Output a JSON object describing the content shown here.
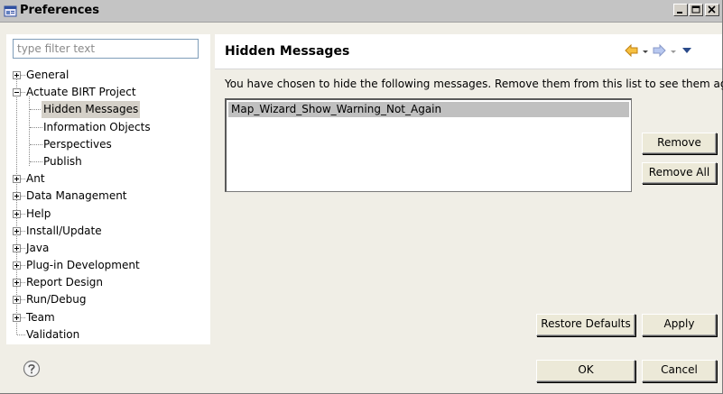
{
  "window": {
    "title": "Preferences"
  },
  "filter": {
    "placeholder": "type filter text"
  },
  "tree": {
    "general": "General",
    "actuate": "Actuate BIRT Project",
    "hidden_messages": "Hidden Messages",
    "information_objects": "Information Objects",
    "perspectives": "Perspectives",
    "publish": "Publish",
    "ant": "Ant",
    "data_management": "Data Management",
    "help": "Help",
    "install_update": "Install/Update",
    "java": "Java",
    "plugin_development": "Plug-in Development",
    "report_design": "Report Design",
    "run_debug": "Run/Debug",
    "team": "Team",
    "validation": "Validation"
  },
  "page": {
    "title": "Hidden Messages",
    "description": "You have chosen to hide the following messages. Remove them from this list to see them again.",
    "messages": [
      "Map_Wizard_Show_Warning_Not_Again"
    ],
    "remove_label": "Remove",
    "remove_all_label": "Remove All",
    "restore_defaults_label": "Restore Defaults",
    "apply_label": "Apply"
  },
  "dialog": {
    "ok_label": "OK",
    "cancel_label": "Cancel"
  },
  "colors": {
    "selection": "#d4d0c8",
    "list_selection": "#c0c0c0",
    "nav_back": "#f0b020",
    "nav_forward": "#4a70c0"
  }
}
